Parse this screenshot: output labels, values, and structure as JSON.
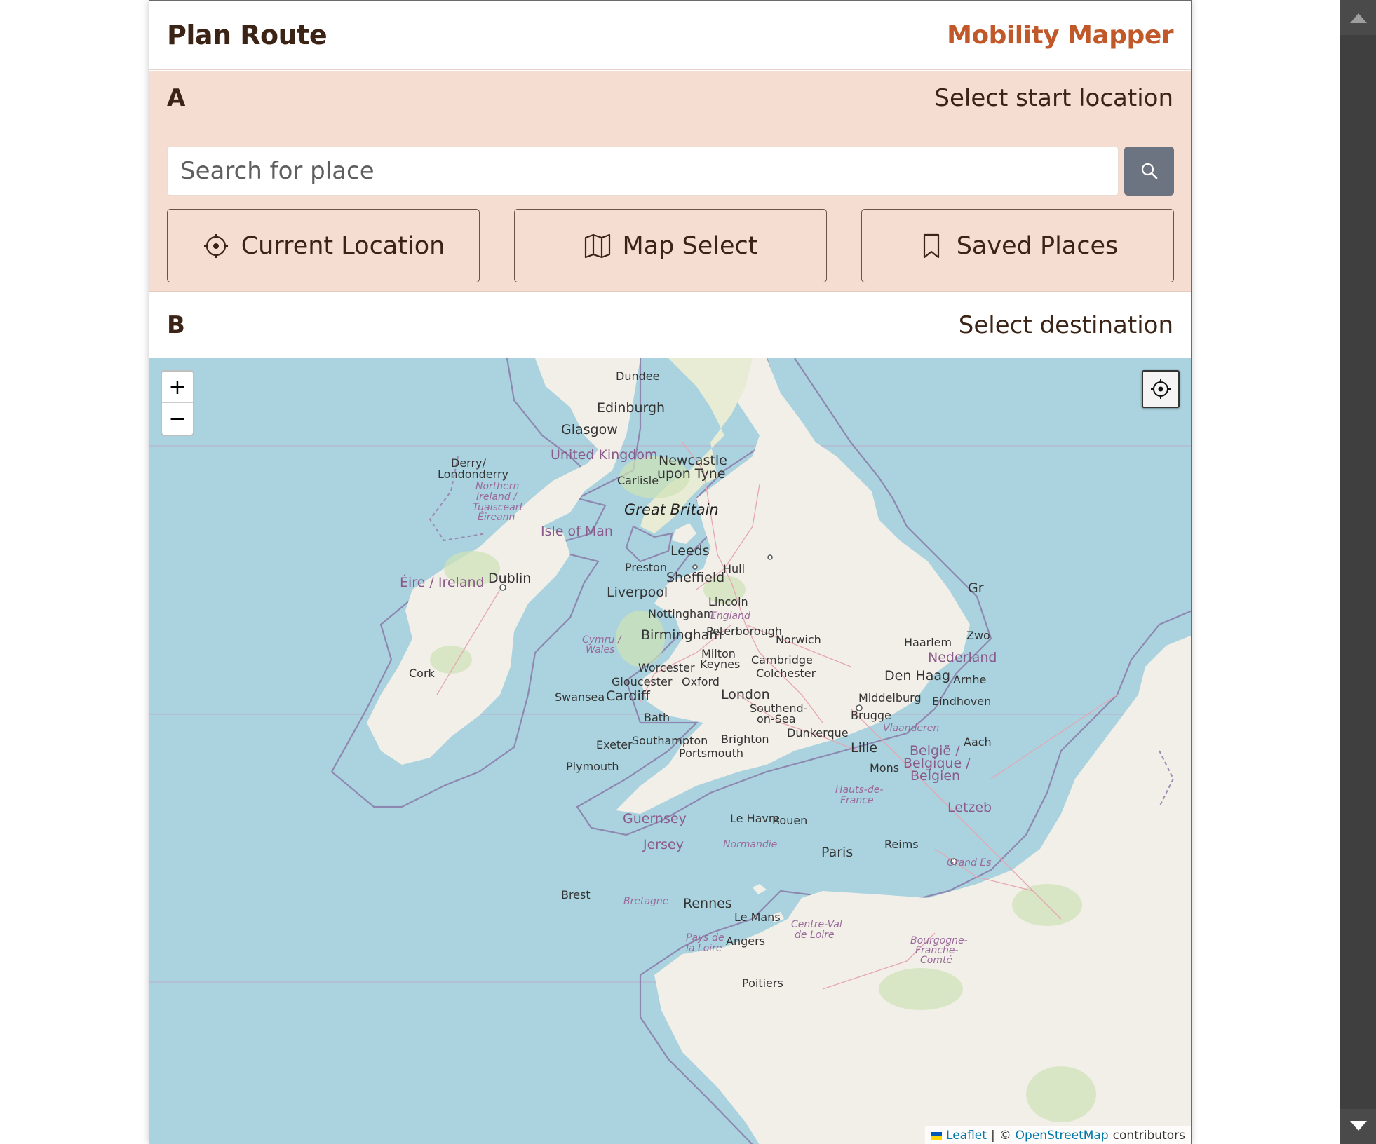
{
  "header": {
    "title": "Plan Route",
    "brand": "Mobility Mapper"
  },
  "start": {
    "marker": "A",
    "label": "Select start location",
    "search_placeholder": "Search for place",
    "buttons": {
      "current_location": "Current Location",
      "map_select": "Map Select",
      "saved_places": "Saved Places"
    }
  },
  "destination": {
    "marker": "B",
    "label": "Select destination"
  },
  "map": {
    "zoom_in": "+",
    "zoom_out": "−",
    "attribution": {
      "leaflet": "Leaflet",
      "separator": "|",
      "copyright": "©",
      "osm": "OpenStreetMap",
      "contributors": "contributors"
    },
    "labels": {
      "dundee": "Dundee",
      "edinburgh": "Edinburgh",
      "glasgow": "Glasgow",
      "united_kingdom": "United Kingdom",
      "newcastle_1": "Newcastle",
      "newcastle_2": "upon Tyne",
      "carlisle": "Carlisle",
      "derry_1": "Derry/",
      "derry_2": "Londonderry",
      "ni_1": "Northern",
      "ni_2": "Ireland /",
      "ni_3": "Tuaisceart",
      "ni_4": "Éireann",
      "great_britain": "Great Britain",
      "isle_of_man": "Isle of Man",
      "leeds": "Leeds",
      "preston": "Preston",
      "hull": "Hull",
      "sheffield": "Sheffield",
      "eire": "Éire / Ireland",
      "dublin": "Dublin",
      "liverpool": "Liverpool",
      "lincoln": "Lincoln",
      "nottingham": "Nottingham",
      "england": "England",
      "peterborough": "Peterborough",
      "birmingham": "Birmingham",
      "norwich": "Norwich",
      "wales_1": "Cymru /",
      "wales_2": "Wales",
      "milton_1": "Milton",
      "milton_2": "Keynes",
      "cambridge": "Cambridge",
      "worcester": "Worcester",
      "colchester": "Colchester",
      "cork": "Cork",
      "gloucester": "Gloucester",
      "oxford": "Oxford",
      "swansea": "Swansea",
      "cardiff": "Cardiff",
      "london": "London",
      "southend_1": "Southend-",
      "southend_2": "on-Sea",
      "bath": "Bath",
      "dunkerque": "Dunkerque",
      "southampton": "Southampton",
      "brighton": "Brighton",
      "exeter": "Exeter",
      "portsmouth": "Portsmouth",
      "lille": "Lille",
      "plymouth": "Plymouth",
      "mons": "Mons",
      "haarlem": "Haarlem",
      "nederland": "Nederland",
      "den_haag": "Den Haag",
      "middelburg": "Middelburg",
      "brugge": "Brugge",
      "eindhoven": "Eindhoven",
      "vlaanderen": "Vlaanderen",
      "belgie_1": "België /",
      "belgie_2": "Belgique /",
      "belgie_3": "Belgien",
      "hauts_1": "Hauts-de-",
      "hauts_2": "France",
      "guernsey": "Guernsey",
      "jersey": "Jersey",
      "le_havre": "Le Havre",
      "rouen": "Rouen",
      "normandie": "Normandie",
      "paris": "Paris",
      "reims": "Reims",
      "brest": "Brest",
      "bretagne": "Bretagne",
      "rennes": "Rennes",
      "le_mans": "Le Mans",
      "centre_1": "Centre-Val",
      "centre_2": "de Loire",
      "pays_1": "Pays de",
      "pays_2": "la Loire",
      "angers": "Angers",
      "bourgogne_1": "Bourgogne-",
      "bourgogne_2": "Franche-",
      "bourgogne_3": "Comté",
      "poitiers": "Poitiers",
      "grand_est": "Grand Es",
      "letzeb": "Letzeb",
      "aach": "Aach",
      "arnhe": "Arnhe",
      "zwo": "Zwo",
      "gr": "Gr"
    }
  },
  "colors": {
    "accent": "#c0582a",
    "section_bg": "#f5ddd2",
    "water": "#aad3df",
    "land": "#f2efe9",
    "text": "#3b2416"
  }
}
